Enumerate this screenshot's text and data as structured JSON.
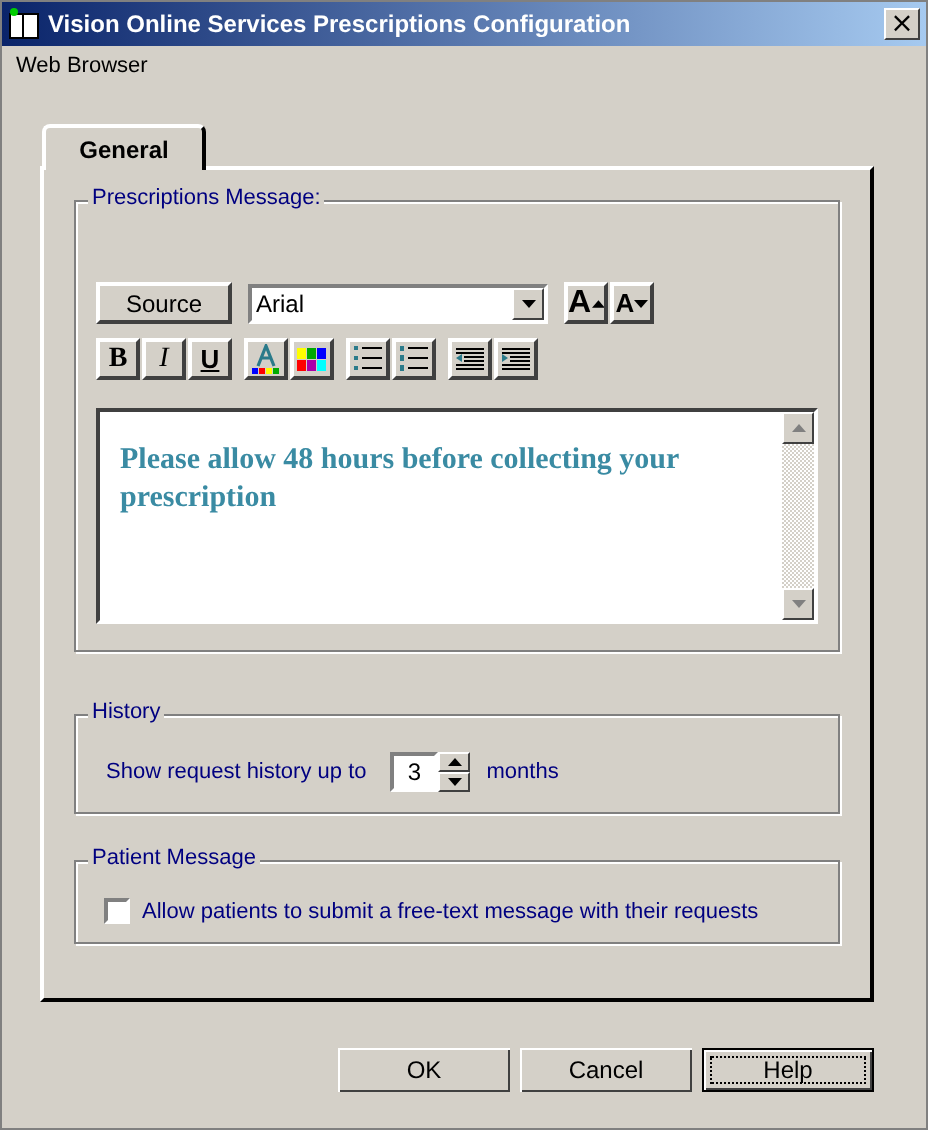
{
  "window": {
    "title": "Vision Online Services Prescriptions Configuration",
    "close": "×"
  },
  "menu": {
    "label": "Web Browser"
  },
  "tabs": [
    {
      "label": "General",
      "selected": true
    }
  ],
  "prescriptions": {
    "title": "Prescriptions Message:",
    "source_button": "Source",
    "font": {
      "value": "Arial"
    },
    "size_buttons": [
      {
        "label": "A",
        "kind": "grow"
      },
      {
        "label": "A",
        "kind": "shrink"
      }
    ],
    "format_groups": [
      [
        {
          "label": "B",
          "kind": "bold"
        },
        {
          "label": "I",
          "kind": "italic"
        },
        {
          "label": "U",
          "kind": "underline"
        }
      ],
      [
        {
          "kind": "text-color"
        },
        {
          "kind": "highlight-color"
        }
      ],
      [
        {
          "kind": "bullet-list"
        },
        {
          "kind": "numbered-list"
        }
      ],
      [
        {
          "kind": "outdent"
        },
        {
          "kind": "indent"
        }
      ]
    ],
    "message": "Please allow 48 hours before collecting your prescription"
  },
  "history": {
    "title": "History",
    "label": "Show request history up to",
    "value": "3",
    "unit": "months"
  },
  "patient_message": {
    "title": "Patient Message",
    "checkbox": {
      "label": "Allow patients to submit a free-text message with their requests",
      "checked": false
    }
  },
  "buttons": [
    {
      "label": "OK",
      "focused": false
    },
    {
      "label": "Cancel",
      "focused": false
    },
    {
      "label": "Help",
      "focused": true
    }
  ]
}
